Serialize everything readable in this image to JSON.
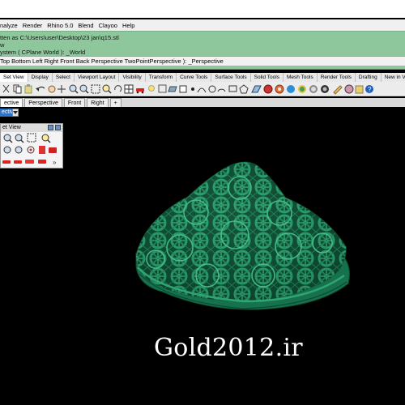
{
  "menu": {
    "items": [
      "nalyze",
      "Render",
      "Rhino 5.0",
      "Blend",
      "Clayoo",
      "Help"
    ]
  },
  "command": {
    "line1": "tten as C:\\Users\\user\\Desktop\\23 jan\\q15.stl",
    "line2": "w",
    "line3": "ystem ( CPlane  World ): _World",
    "prompt": "Top  Bottom  Left  Right  Front  Back  Perspective  TwoPointPerspective ): _Perspective"
  },
  "toolbar_tabs": [
    "Set View",
    "Display",
    "Select",
    "Viewport Layout",
    "Visibility",
    "Transform",
    "Curve Tools",
    "Surface Tools",
    "Solid Tools",
    "Mesh Tools",
    "Render Tools",
    "Drafting",
    "New in V5"
  ],
  "toolbar_active_tab": "Set View",
  "viewport_tabs": [
    "ective",
    "Perspective",
    "Front",
    "Right"
  ],
  "viewport_add": "+",
  "viewport_label": "ective",
  "setview_panel": {
    "title": "et View"
  },
  "more_glyph": "»",
  "object_color": "#1f8c63",
  "watermark": "Gold2012.ir"
}
